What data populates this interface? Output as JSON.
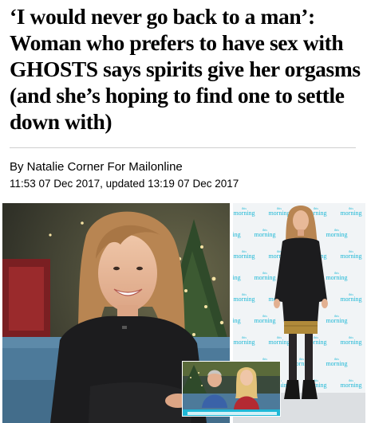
{
  "article": {
    "headline": "‘I would never go back to a man’: Woman who prefers to have sex with GHOSTS says spirits give her orgasms (and she’s hoping to find one to settle down with)",
    "byline": "By Natalie Corner For Mailonline",
    "dateline": "11:53 07 Dec 2017, updated 13:19 07 Dec 2017"
  },
  "backdrop": {
    "tile_small": "this",
    "tile_word": "morning"
  },
  "colors": {
    "brand_cyan": "#1fb8d6",
    "sweater": "#1c1c1e",
    "hair": "#b88552",
    "sofa": "#4d7a9a",
    "skirt": "#b08a3a"
  }
}
